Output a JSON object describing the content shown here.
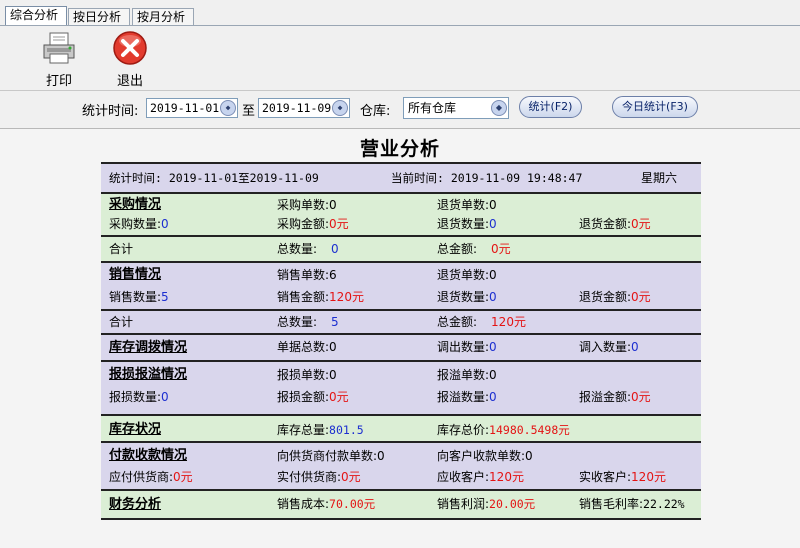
{
  "tabs": [
    "综合分析",
    "按日分析",
    "按月分析"
  ],
  "toolbar": {
    "print_label": "打印",
    "exit_label": "退出"
  },
  "filter": {
    "date_label": "统计时间:",
    "from_date": "2019-11-01",
    "to_label": "至",
    "to_date": "2019-11-09",
    "warehouse_label": "仓库:",
    "warehouse_value": "所有仓库",
    "stat_button": "统计(F2)",
    "today_button": "今日统计(F3)"
  },
  "report": {
    "title": "营业分析",
    "period_text": "统计时间: 2019-11-01至2019-11-09",
    "current_text": "当前时间: 2019-11-09 19:48:47",
    "weekday": "星期六",
    "purchase": {
      "heading": "采购情况",
      "order_count": "采购单数:0",
      "return_count": "退货单数:0",
      "qty_label": "采购数量:",
      "qty_value": "0",
      "amount_label": "采购金额:",
      "amount_value": "0元",
      "return_qty_label": "退货数量:",
      "return_qty_value": "0",
      "return_amount_label": "退货金额:",
      "return_amount_value": "0元",
      "total_label": "合计",
      "total_qty_label": "总数量:",
      "total_qty_value": "0",
      "total_amount_label": "总金额:",
      "total_amount_value": "0元"
    },
    "sales": {
      "heading": "销售情况",
      "order_count": "销售单数:6",
      "return_count": "退货单数:0",
      "qty_label": "销售数量:",
      "qty_value": "5",
      "amount_label": "销售金额:",
      "amount_value": "120元",
      "return_qty_label": "退货数量:",
      "return_qty_value": "0",
      "return_amount_label": "退货金额:",
      "return_amount_value": "0元",
      "total_label": "合计",
      "total_qty_label": "总数量:",
      "total_qty_value": "5",
      "total_amount_label": "总金额:",
      "total_amount_value": "120元"
    },
    "transfer": {
      "heading": "库存调拨情况",
      "doc_count": "单据总数:0",
      "out_label": "调出数量:",
      "out_value": "0",
      "in_label": "调入数量:",
      "in_value": "0"
    },
    "loss": {
      "heading": "报损报溢情况",
      "loss_count": "报损单数:0",
      "gain_count": "报溢单数:0",
      "loss_qty_label": "报损数量:",
      "loss_qty_value": "0",
      "loss_amount_label": "报损金额:",
      "loss_amount_value": "0元",
      "gain_qty_label": "报溢数量:",
      "gain_qty_value": "0",
      "gain_amount_label": "报溢金额:",
      "gain_amount_value": "0元"
    },
    "stock": {
      "heading": "库存状况",
      "qty_label": "库存总量:",
      "qty_value": "801.5",
      "price_label": "库存总价:",
      "price_value": "14980.5498元"
    },
    "payment": {
      "heading": "付款收款情况",
      "pay_count": "向供货商付款单数:0",
      "receive_count": "向客户收款单数:0",
      "payable_label": "应付供货商:",
      "payable_value": "0元",
      "paid_label": "实付供货商:",
      "paid_value": "0元",
      "receivable_label": "应收客户:",
      "receivable_value": "120元",
      "received_label": "实收客户:",
      "received_value": "120元"
    },
    "finance": {
      "heading": "财务分析",
      "cost_label": "销售成本:",
      "cost_value": "70.00元",
      "profit_label": "销售利润:",
      "profit_value": "20.00元",
      "margin_label": "销售毛利率:",
      "margin_value": "22.22%"
    }
  },
  "icons": {
    "print": "printer-icon",
    "exit": "close-circle-icon",
    "spin": "spinner-icon"
  },
  "colors": {
    "purple_row": "#d9d6ec",
    "green_row": "#dbeed5",
    "value_blue": "#1c2fd0",
    "value_red": "#e41414"
  }
}
